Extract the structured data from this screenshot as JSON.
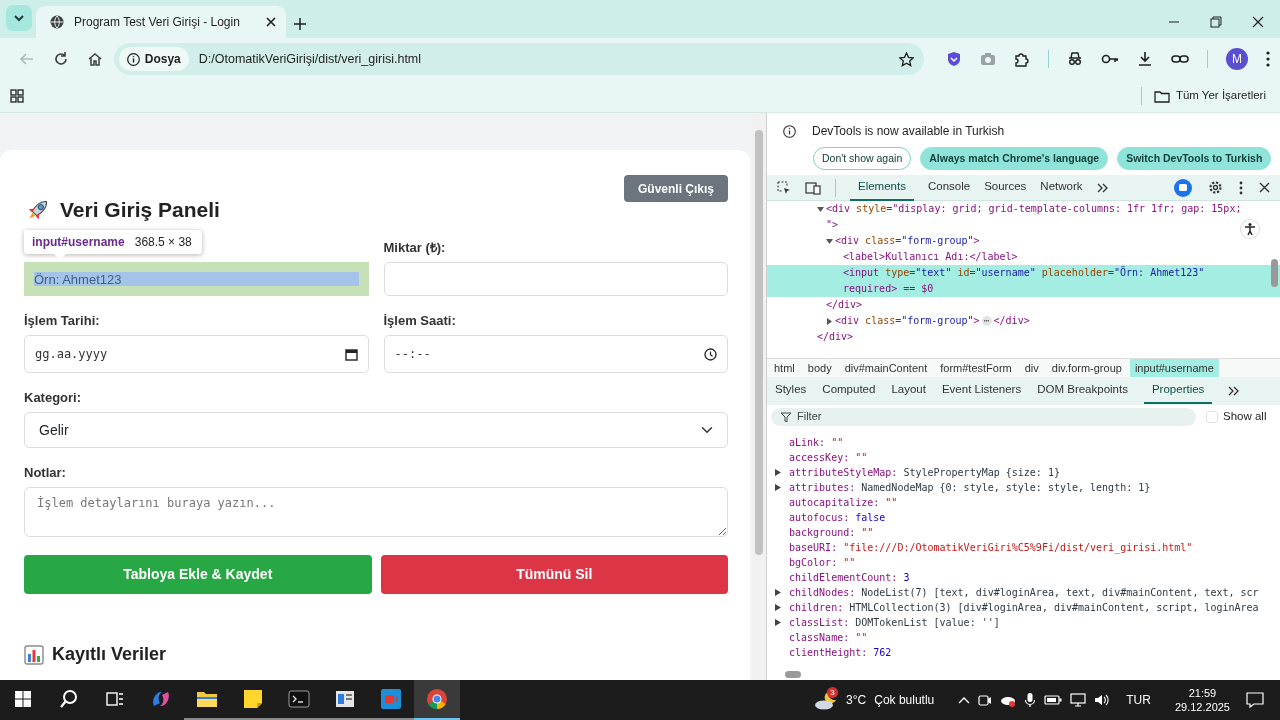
{
  "browser": {
    "tabs": [
      {
        "title": "Program Test Veri Girişi - Login",
        "selected": true
      }
    ],
    "nav_buttons": [
      {
        "kind": "back",
        "disabled": true
      },
      {
        "kind": "reload",
        "disabled": false
      },
      {
        "kind": "home",
        "disabled": false
      }
    ],
    "address": {
      "chip": "Dosya",
      "url": "D:/OtomatikVeriGirişi/dist/veri_girisi.html"
    },
    "avatar": "M",
    "all_bookmarks": "Tüm Yer İşaretleri"
  },
  "page": {
    "title": "Veri Giriş Paneli",
    "logout": "Güvenli Çıkış",
    "tooltip": {
      "element": "input#username",
      "size": "368.5 × 38"
    },
    "fields": [
      {
        "kind": "text",
        "placeholder": "Örn: Ahmet123",
        "highlighted": true,
        "wide": false
      },
      {
        "kind": "text",
        "label": "Miktar (₺):",
        "highlighted": false,
        "wide": false
      },
      {
        "kind": "date",
        "label": "İşlem Tarihi:",
        "format": "gg.aa.yyyy",
        "wide": false
      },
      {
        "kind": "time",
        "label": "İşlem Saati:",
        "format": "--:--",
        "wide": false
      },
      {
        "kind": "select",
        "label": "Kategori:",
        "value": "Gelir",
        "wide": true
      },
      {
        "kind": "textarea",
        "label": "Notlar:",
        "placeholder": "İşlem detaylarını buraya yazın...",
        "wide": true
      }
    ],
    "buttons": [
      {
        "label": "Tabloya Ekle & Kaydet",
        "kind": "save"
      },
      {
        "label": "Tümünü Sil",
        "kind": "delete"
      }
    ],
    "section_title": "Kayıtlı Veriler"
  },
  "devtools": {
    "notice": {
      "text": "DevTools is now available in Turkish",
      "buttons": [
        {
          "label": "Don't show again",
          "kind": "outline"
        },
        {
          "label": "Always match Chrome's language",
          "kind": "filled"
        },
        {
          "label": "Switch DevTools to Turkish",
          "kind": "filled"
        }
      ]
    },
    "tabs": [
      {
        "label": "Elements",
        "selected": true
      },
      {
        "label": "Console",
        "selected": false
      },
      {
        "label": "Sources",
        "selected": false
      },
      {
        "label": "Network",
        "selected": false
      }
    ],
    "tree": [
      {
        "lines": [
          "<div style=\"display: grid; grid-template-columns: 1fr 1fr; gap: 15px;",
          "\">"
        ],
        "expanded": true,
        "selected": false,
        "close": "</div>",
        "children": [
          {
            "lines": [
              "<div class=\"form-group\">"
            ],
            "expanded": true,
            "selected": false,
            "close": "</div>",
            "children": [
              {
                "lines": [
                  "<label>Kullanıcı Adı:</label>"
                ],
                "selected": false
              },
              {
                "lines": [
                  "<input type=\"text\" id=\"username\" placeholder=\"Örn: Ahmet123\"",
                  "required> == $0"
                ],
                "selected": true
              }
            ]
          },
          {
            "lines": [
              "<div class=\"form-group\">"
            ],
            "expanded": false,
            "selected": false,
            "summary": "⋯",
            "close": "</div>"
          }
        ]
      }
    ],
    "breadcrumbs": [
      {
        "label": "html",
        "selected": false
      },
      {
        "label": "body",
        "selected": false
      },
      {
        "label": "div#mainContent",
        "selected": false
      },
      {
        "label": "form#testForm",
        "selected": false
      },
      {
        "label": "div",
        "selected": false
      },
      {
        "label": "div.form-group",
        "selected": false
      },
      {
        "label": "input#username",
        "selected": true
      }
    ],
    "panel_tabs": [
      {
        "label": "Styles",
        "selected": false
      },
      {
        "label": "Computed",
        "selected": false
      },
      {
        "label": "Layout",
        "selected": false
      },
      {
        "label": "Event Listeners",
        "selected": false
      },
      {
        "label": "DOM Breakpoints",
        "selected": false
      },
      {
        "label": "Properties",
        "selected": true
      }
    ],
    "filter": {
      "placeholder": "Filter"
    },
    "show_all": {
      "label": "Show all",
      "checked": false
    },
    "properties": [
      {
        "name": "aLink:",
        "value": "\"\"",
        "kind": "string",
        "expandable": false
      },
      {
        "name": "accessKey:",
        "value": "\"\"",
        "kind": "string",
        "expandable": false
      },
      {
        "name": "attributeStyleMap:",
        "value": "StylePropertyMap {size: 1}",
        "kind": "object",
        "expandable": true
      },
      {
        "name": "attributes:",
        "value": "NamedNodeMap {0: style, style: style, length: 1}",
        "kind": "object",
        "expandable": true
      },
      {
        "name": "autocapitalize:",
        "value": "\"\"",
        "kind": "string",
        "expandable": false
      },
      {
        "name": "autofocus:",
        "value": "false",
        "kind": "keyword",
        "expandable": false
      },
      {
        "name": "background:",
        "value": "\"\"",
        "kind": "string",
        "expandable": false
      },
      {
        "name": "baseURI:",
        "value": "\"file:///D:/OtomatikVeriGiri%C5%9Fi/dist/veri_girisi.html\"",
        "kind": "string",
        "expandable": false
      },
      {
        "name": "bgColor:",
        "value": "\"\"",
        "kind": "string",
        "expandable": false
      },
      {
        "name": "childElementCount:",
        "value": "3",
        "kind": "keyword",
        "expandable": false
      },
      {
        "name": "childNodes:",
        "value": "NodeList(7) [text, div#loginArea, text, div#mainContent, text, scr",
        "kind": "object",
        "expandable": true
      },
      {
        "name": "children:",
        "value": "HTMLCollection(3) [div#loginArea, div#mainContent, script, loginArea",
        "kind": "object",
        "expandable": true
      },
      {
        "name": "classList:",
        "value": "DOMTokenList [value: '']",
        "kind": "object",
        "expandable": true
      },
      {
        "name": "className:",
        "value": "\"\"",
        "kind": "string",
        "expandable": false
      },
      {
        "name": "clientHeight:",
        "value": "762",
        "kind": "keyword",
        "expandable": false
      }
    ]
  },
  "taskbar": {
    "apps": [
      {
        "kind": "swirl",
        "open": false,
        "selected": false
      },
      {
        "kind": "folder",
        "open": true,
        "selected": false
      },
      {
        "kind": "note",
        "open": true,
        "selected": false
      },
      {
        "kind": "terminal",
        "open": true,
        "selected": false
      },
      {
        "kind": "window",
        "open": true,
        "selected": false
      },
      {
        "kind": "video",
        "open": true,
        "selected": false
      },
      {
        "kind": "browser",
        "open": true,
        "selected": true
      }
    ],
    "weather": {
      "badge": "3",
      "temperature": "3°C",
      "condition": "Çok bulutlu"
    },
    "language": "TUR",
    "time": "21:59",
    "date": "29.12.2025"
  }
}
